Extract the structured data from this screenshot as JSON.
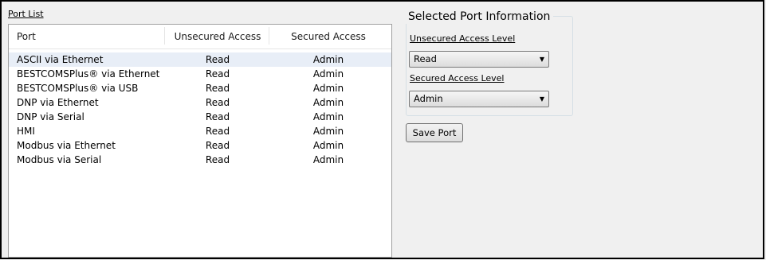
{
  "port_list": {
    "label": "Port List",
    "columns": [
      "Port",
      "Unsecured Access",
      "Secured Access"
    ],
    "rows": [
      {
        "port": "ASCII via Ethernet",
        "unsecured": "Read",
        "secured": "Admin",
        "selected": true
      },
      {
        "port": "BESTCOMSPlus® via Ethernet",
        "unsecured": "Read",
        "secured": "Admin"
      },
      {
        "port": "BESTCOMSPlus® via USB",
        "unsecured": "Read",
        "secured": "Admin"
      },
      {
        "port": "DNP via Ethernet",
        "unsecured": "Read",
        "secured": "Admin"
      },
      {
        "port": "DNP via Serial",
        "unsecured": "Read",
        "secured": "Admin"
      },
      {
        "port": "HMI",
        "unsecured": "Read",
        "secured": "Admin"
      },
      {
        "port": "Modbus via Ethernet",
        "unsecured": "Read",
        "secured": "Admin"
      },
      {
        "port": "Modbus via Serial",
        "unsecured": "Read",
        "secured": "Admin"
      }
    ]
  },
  "selected_port": {
    "title": "Selected Port Information",
    "unsecured_label": "Unsecured Access Level",
    "unsecured_value": "Read",
    "secured_label": "Secured Access Level",
    "secured_value": "Admin"
  },
  "save_button": {
    "label": "Save Port"
  },
  "icons": {
    "dropdown": "chevron-down-icon"
  }
}
